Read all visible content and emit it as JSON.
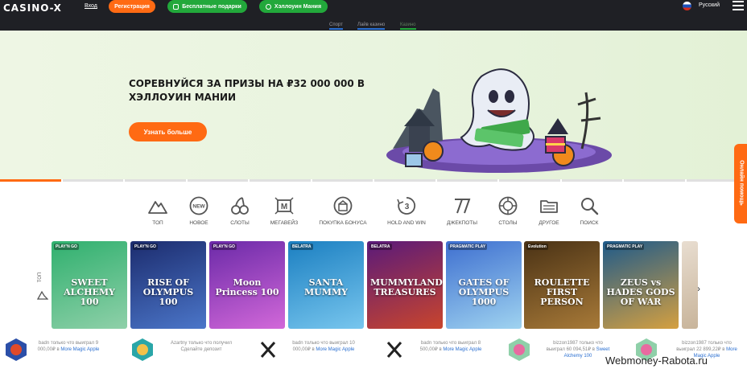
{
  "header": {
    "logo": "CASINO-X",
    "login": "Вход",
    "register": "Регистрация",
    "gifts": "Бесплатные подарки",
    "halloween": "Хэллоуин Мания",
    "language": "Русский"
  },
  "subnav": [
    {
      "label": "Спорт",
      "color": "#2a6fd1"
    },
    {
      "label": "Лайв казино",
      "color": "#2a6fd1"
    },
    {
      "label": "Казино",
      "color": "#22a83b"
    }
  ],
  "banner": {
    "title": "СОРЕВНУЙСЯ ЗА ПРИЗЫ НА ₽32 000 000 В ХЭЛЛОУИН МАНИИ",
    "button": "Узнать больше"
  },
  "categories": [
    {
      "label": "ТОП",
      "icon": "mountain-icon"
    },
    {
      "label": "НОВОЕ",
      "icon": "new-badge-icon"
    },
    {
      "label": "СЛОТЫ",
      "icon": "cherries-icon"
    },
    {
      "label": "МЕГАВЕЙЗ",
      "icon": "megaways-icon"
    },
    {
      "label": "ПОКУПКА БОНУСА",
      "icon": "bonus-buy-icon"
    },
    {
      "label": "HOLD AND WIN",
      "icon": "hold-and-win-icon"
    },
    {
      "label": "ДЖЕКПОТЫ",
      "icon": "sevens-icon"
    },
    {
      "label": "СТОЛЫ",
      "icon": "chip-icon"
    },
    {
      "label": "ДРУГОЕ",
      "icon": "folder-icon"
    },
    {
      "label": "ПОИСК",
      "icon": "search-icon"
    }
  ],
  "games_label": "ТОП",
  "games": [
    {
      "title": "SWEET ALCHEMY 100",
      "provider": "PLAY'N GO",
      "color": "#2fb06e",
      "color2": "#8fd0a9"
    },
    {
      "title": "RISE OF OLYMPUS 100",
      "provider": "PLAY'N GO",
      "color": "#1c2c6e",
      "color2": "#4b76c9"
    },
    {
      "title": "Moon Princess 100",
      "provider": "PLAY'N GO",
      "color": "#6b2aa8",
      "color2": "#d268d9"
    },
    {
      "title": "SANTA MUMMY",
      "provider": "BELATRA",
      "color": "#1b7fc1",
      "color2": "#78c6ee"
    },
    {
      "title": "MUMMYLAND TREASURES",
      "provider": "BELATRA",
      "color": "#5a1a7a",
      "color2": "#c9452c"
    },
    {
      "title": "GATES OF OLYMPUS 1000",
      "provider": "PRAGMATIC PLAY",
      "color": "#3e6fd0",
      "color2": "#9fd3f0"
    },
    {
      "title": "ROULETTE FIRST PERSON",
      "provider": "Evolution",
      "color": "#4a3215",
      "color2": "#a87a38"
    },
    {
      "title": "ZEUS vs HADES GODS OF WAR",
      "provider": "PRAGMATIC PLAY",
      "color": "#1e5a8a",
      "color2": "#d5a040"
    }
  ],
  "winners": [
    {
      "user": "badn",
      "text": "только что выиграл 9 000,00₽ в",
      "game": "More Magic Apple"
    },
    {
      "user": "Azartny",
      "text": "только что получил Сделайте депозит",
      "game": ""
    },
    {
      "user": "badn",
      "text": "только что выиграл 10 000,00₽ в",
      "game": "More Magic Apple"
    },
    {
      "user": "badn",
      "text": "только что выиграл 8 500,00₽ в",
      "game": "More Magic Apple"
    },
    {
      "user": "bizzon1987",
      "text": "только что выиграл 60 094,51₽ в",
      "game": "Sweet Alchemy 100"
    },
    {
      "user": "bizzon1987",
      "text": "только что выиграл 22 899,22₽ в",
      "game": "More Magic Apple"
    }
  ],
  "help": "Онлайн помощь",
  "watermark": "Webmoney-Rabota.ru",
  "colors": {
    "accent": "#ff6a13",
    "green": "#22a83b",
    "header": "#1f2025"
  }
}
